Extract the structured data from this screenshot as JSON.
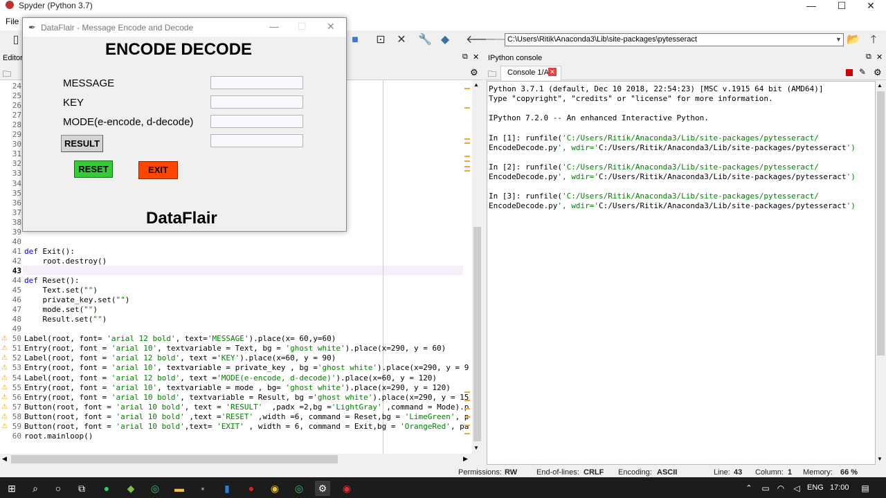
{
  "app": {
    "title": "Spyder (Python 3.7)",
    "menu_file": "File",
    "minimize": "—",
    "maximize": "☐",
    "close": "✕"
  },
  "toolbar": {
    "path": "C:\\Users\\Ritik\\Anaconda3\\Lib\\site-packages\\pytesseract"
  },
  "editor": {
    "header_label": "Editor",
    "lines": [
      {
        "n": "24",
        "code": ""
      },
      {
        "n": "25",
        "code": ""
      },
      {
        "n": "26",
        "code": ""
      },
      {
        "n": "27",
        "code": ""
      },
      {
        "n": "28",
        "code": ""
      },
      {
        "n": "29",
        "code": ""
      },
      {
        "n": "30",
        "code": ""
      },
      {
        "n": "31",
        "code": ""
      },
      {
        "n": "32",
        "code": ""
      },
      {
        "n": "33",
        "code": ""
      },
      {
        "n": "34",
        "code": ""
      },
      {
        "n": "35",
        "code": ""
      },
      {
        "n": "36",
        "code": ""
      },
      {
        "n": "37",
        "code": ""
      },
      {
        "n": "38",
        "code": ""
      },
      {
        "n": "39",
        "code": ""
      },
      {
        "n": "40",
        "code": ""
      },
      {
        "n": "41",
        "code": "def Exit():"
      },
      {
        "n": "42",
        "code": "    root.destroy()"
      },
      {
        "n": "43",
        "code": ""
      },
      {
        "n": "44",
        "code": "def Reset():"
      },
      {
        "n": "45",
        "code": "    Text.set(\"\")"
      },
      {
        "n": "46",
        "code": "    private_key.set(\"\")"
      },
      {
        "n": "47",
        "code": "    mode.set(\"\")"
      },
      {
        "n": "48",
        "code": "    Result.set(\"\")"
      },
      {
        "n": "49",
        "code": ""
      },
      {
        "n": "50",
        "code": "Label(root, font= 'arial 12 bold', text='MESSAGE').place(x= 60,y=60)"
      },
      {
        "n": "51",
        "code": "Entry(root, font = 'arial 10', textvariable = Text, bg = 'ghost white').place(x=290, y = 60)"
      },
      {
        "n": "52",
        "code": "Label(root, font = 'arial 12 bold', text ='KEY').place(x=60, y = 90)"
      },
      {
        "n": "53",
        "code": "Entry(root, font = 'arial 10', textvariable = private_key , bg ='ghost white').place(x=290, y = 9"
      },
      {
        "n": "54",
        "code": "Label(root, font = 'arial 12 bold', text ='MODE(e-encode, d-decode)').place(x=60, y = 120)"
      },
      {
        "n": "55",
        "code": "Entry(root, font = 'arial 10', textvariable = mode , bg= 'ghost white').place(x=290, y = 120)"
      },
      {
        "n": "56",
        "code": "Entry(root, font = 'arial 10 bold', textvariable = Result, bg ='ghost white').place(x=290, y = 15"
      },
      {
        "n": "57",
        "code": "Button(root, font = 'arial 10 bold', text = 'RESULT'  ,padx =2,bg ='LightGray' ,command = Mode).p"
      },
      {
        "n": "58",
        "code": "Button(root, font = 'arial 10 bold' ,text ='RESET' ,width =6, command = Reset,bg = 'LimeGreen', p"
      },
      {
        "n": "59",
        "code": "Button(root, font = 'arial 10 bold',text= 'EXIT' , width = 6, command = Exit,bg = 'OrangeRed', pa"
      },
      {
        "n": "60",
        "code": "root.mainloop()"
      }
    ]
  },
  "console": {
    "header_label": "IPython console",
    "tab_label": "Console 1/A",
    "lines": [
      "Python 3.7.1 (default, Dec 10 2018, 22:54:23) [MSC v.1915 64 bit (AMD64)]",
      "Type \"copyright\", \"credits\" or \"license\" for more information.",
      "",
      "IPython 7.2.0 -- An enhanced Interactive Python.",
      "",
      "In [1]: runfile('C:/Users/Ritik/Anaconda3/Lib/site-packages/pytesseract/",
      "EncodeDecode.py', wdir='C:/Users/Ritik/Anaconda3/Lib/site-packages/pytesseract')",
      "",
      "In [2]: runfile('C:/Users/Ritik/Anaconda3/Lib/site-packages/pytesseract/",
      "EncodeDecode.py', wdir='C:/Users/Ritik/Anaconda3/Lib/site-packages/pytesseract')",
      "",
      "In [3]: runfile('C:/Users/Ritik/Anaconda3/Lib/site-packages/pytesseract/",
      "EncodeDecode.py', wdir='C:/Users/Ritik/Anaconda3/Lib/site-packages/pytesseract')"
    ]
  },
  "status": {
    "permissions_label": "Permissions:",
    "permissions_value": "RW",
    "eol_label": "End-of-lines:",
    "eol_value": "CRLF",
    "encoding_label": "Encoding:",
    "encoding_value": "ASCII",
    "line_label": "Line:",
    "line_value": "43",
    "column_label": "Column:",
    "column_value": "1",
    "memory_label": "Memory:",
    "memory_value": "66 %"
  },
  "tk": {
    "window_title": "DataFlair - Message Encode and Decode",
    "heading": "ENCODE DECODE",
    "label_message": "MESSAGE",
    "label_key": "KEY",
    "label_mode": "MODE(e-encode, d-decode)",
    "btn_result": "RESULT",
    "btn_reset": "RESET",
    "btn_exit": "EXIT",
    "brand": "DataFlair",
    "entry_message": "",
    "entry_key": "",
    "entry_mode": "",
    "entry_result": ""
  },
  "taskbar": {
    "language": "ENG",
    "time": "17:00"
  }
}
